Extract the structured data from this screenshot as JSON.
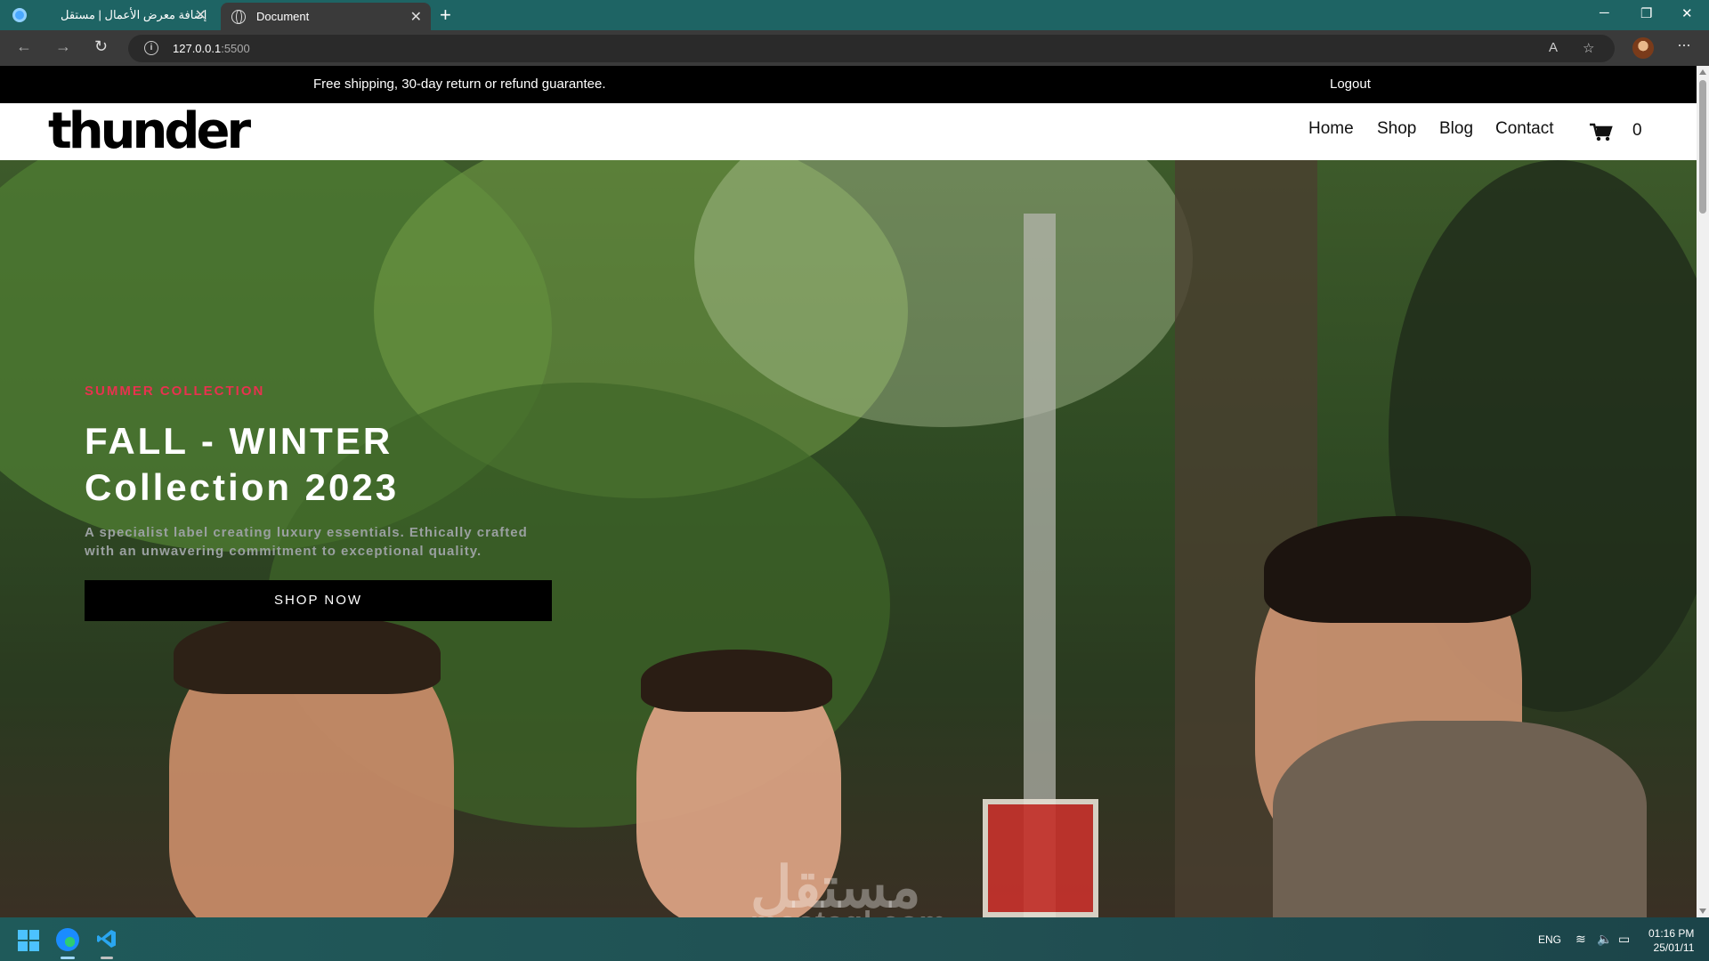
{
  "browser": {
    "tabs": [
      {
        "title": "إضافة معرض الأعمال | مستقل",
        "active": false
      },
      {
        "title": "Document",
        "active": true
      }
    ],
    "url_host": "127.0.0.1",
    "url_port": ":5500"
  },
  "topbar": {
    "shipping_text": "Free shipping, 30-day return or refund guarantee.",
    "logout_label": "Logout"
  },
  "header": {
    "logo": "thunder",
    "nav": [
      "Home",
      "Shop",
      "Blog",
      "Contact"
    ],
    "cart_count": "0"
  },
  "hero": {
    "eyebrow": "SUMMER COLLECTION",
    "headline_line1": "FALL - WINTER",
    "headline_line2": "Collection 2023",
    "subtext": "A specialist label creating luxury essentials. Ethically crafted with an unwavering commitment to exceptional quality.",
    "button_label": "SHOP NOW"
  },
  "watermark": {
    "arabic": "مستقل",
    "latin": "mostaql.com"
  },
  "taskbar": {
    "lang": "ENG",
    "time": "01:16 PM",
    "date": "25/01/11"
  },
  "colors": {
    "accent": "#e8324f",
    "tab_strip": "#1e6464",
    "topbar": "#000000"
  }
}
